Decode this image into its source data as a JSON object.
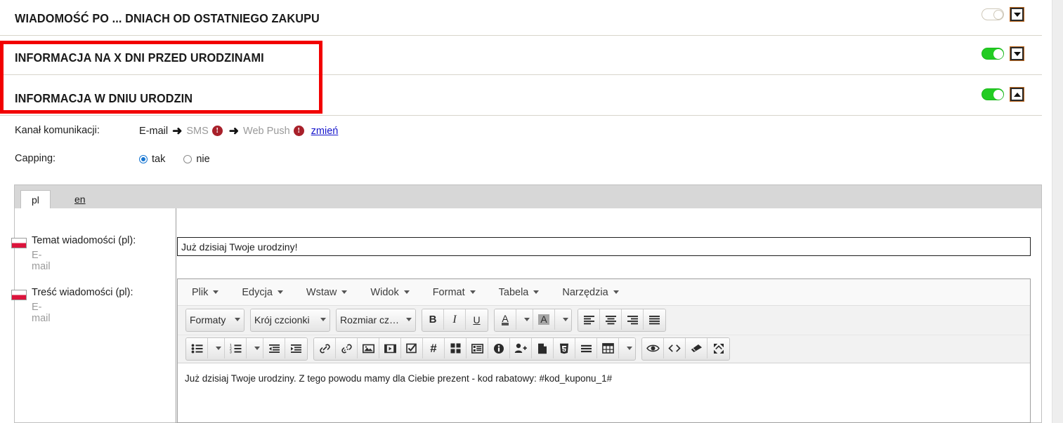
{
  "accordion": {
    "rows": [
      {
        "title": "WIADOMOŚĆ PO ... DNIACH OD OSTATNIEGO ZAKUPU",
        "toggle_state": "off",
        "chevron": "down"
      },
      {
        "title": "INFORMACJA NA X DNI PRZED URODZINAMI",
        "toggle_state": "on",
        "chevron": "down"
      },
      {
        "title": "INFORMACJA W DNIU URODZIN",
        "toggle_state": "on",
        "chevron": "up"
      }
    ]
  },
  "details": {
    "channel_label": "Kanał komunikacji:",
    "channel_steps": [
      {
        "name": "E-mail",
        "state": "active",
        "warning": false
      },
      {
        "name": "SMS",
        "state": "muted",
        "warning": true
      },
      {
        "name": "Web Push",
        "state": "muted",
        "warning": true
      }
    ],
    "arrow": "➜",
    "warning_glyph": "!",
    "change_link": "zmień",
    "capping_label": "Capping:",
    "capping_options": [
      {
        "label": "tak",
        "checked": true
      },
      {
        "label": "nie",
        "checked": false
      }
    ]
  },
  "tabs": [
    {
      "label": "pl",
      "active": true
    },
    {
      "label": "en",
      "active": false
    }
  ],
  "fields": {
    "subject": {
      "title": "Temat wiadomości (pl):",
      "subtitle": "E-mail",
      "flag": "pl-flag-icon",
      "value": "Już dzisiaj Twoje urodziny!",
      "placeholder": ""
    },
    "body": {
      "title": "Treść wiadomości (pl):",
      "subtitle": "E-mail",
      "flag": "pl-flag-icon"
    }
  },
  "editor": {
    "menubar": [
      "Plik",
      "Edycja",
      "Wstaw",
      "Widok",
      "Format",
      "Tabela",
      "Narzędzia"
    ],
    "toolbar_row1": {
      "selects": [
        "Formaty",
        "Krój czcionki",
        "Rozmiar cz…"
      ],
      "format_buttons": [
        {
          "name": "bold-button",
          "glyph": "B"
        },
        {
          "name": "italic-button",
          "glyph": "I"
        },
        {
          "name": "underline-button",
          "glyph": "U"
        }
      ],
      "color_buttons": [
        {
          "name": "text-color-button",
          "glyph": "A"
        },
        {
          "name": "background-color-button",
          "glyph": "A"
        }
      ],
      "align_buttons": [
        "align-left-button",
        "align-center-button",
        "align-right-button",
        "align-justify-button"
      ]
    },
    "toolbar_row2": {
      "list_buttons": [
        "bullet-list-button",
        "numbered-list-button",
        "outdent-button",
        "indent-button"
      ],
      "insert_buttons": [
        "link-button",
        "unlink-button",
        "image-button",
        "media-button",
        "checkbox-button",
        "hash-button",
        "blocks-button",
        "template-button",
        "info-button",
        "add-user-button",
        "page-break-button",
        "html5-button",
        "line-button",
        "table-button"
      ],
      "view_buttons": [
        "preview-button",
        "source-code-button",
        "clear-formatting-button",
        "fullscreen-button"
      ]
    },
    "content": "Już dzisiaj Twoje urodziny. Z tego powodu mamy dla Ciebie prezent - kod rabatowy: #kod_kuponu_1#"
  },
  "colors": {
    "highlight_box": "#f20000",
    "toggle_on": "#22cc22",
    "link": "#1515cc",
    "warning": "#a8202a",
    "radio_checked": "#1675d1"
  }
}
